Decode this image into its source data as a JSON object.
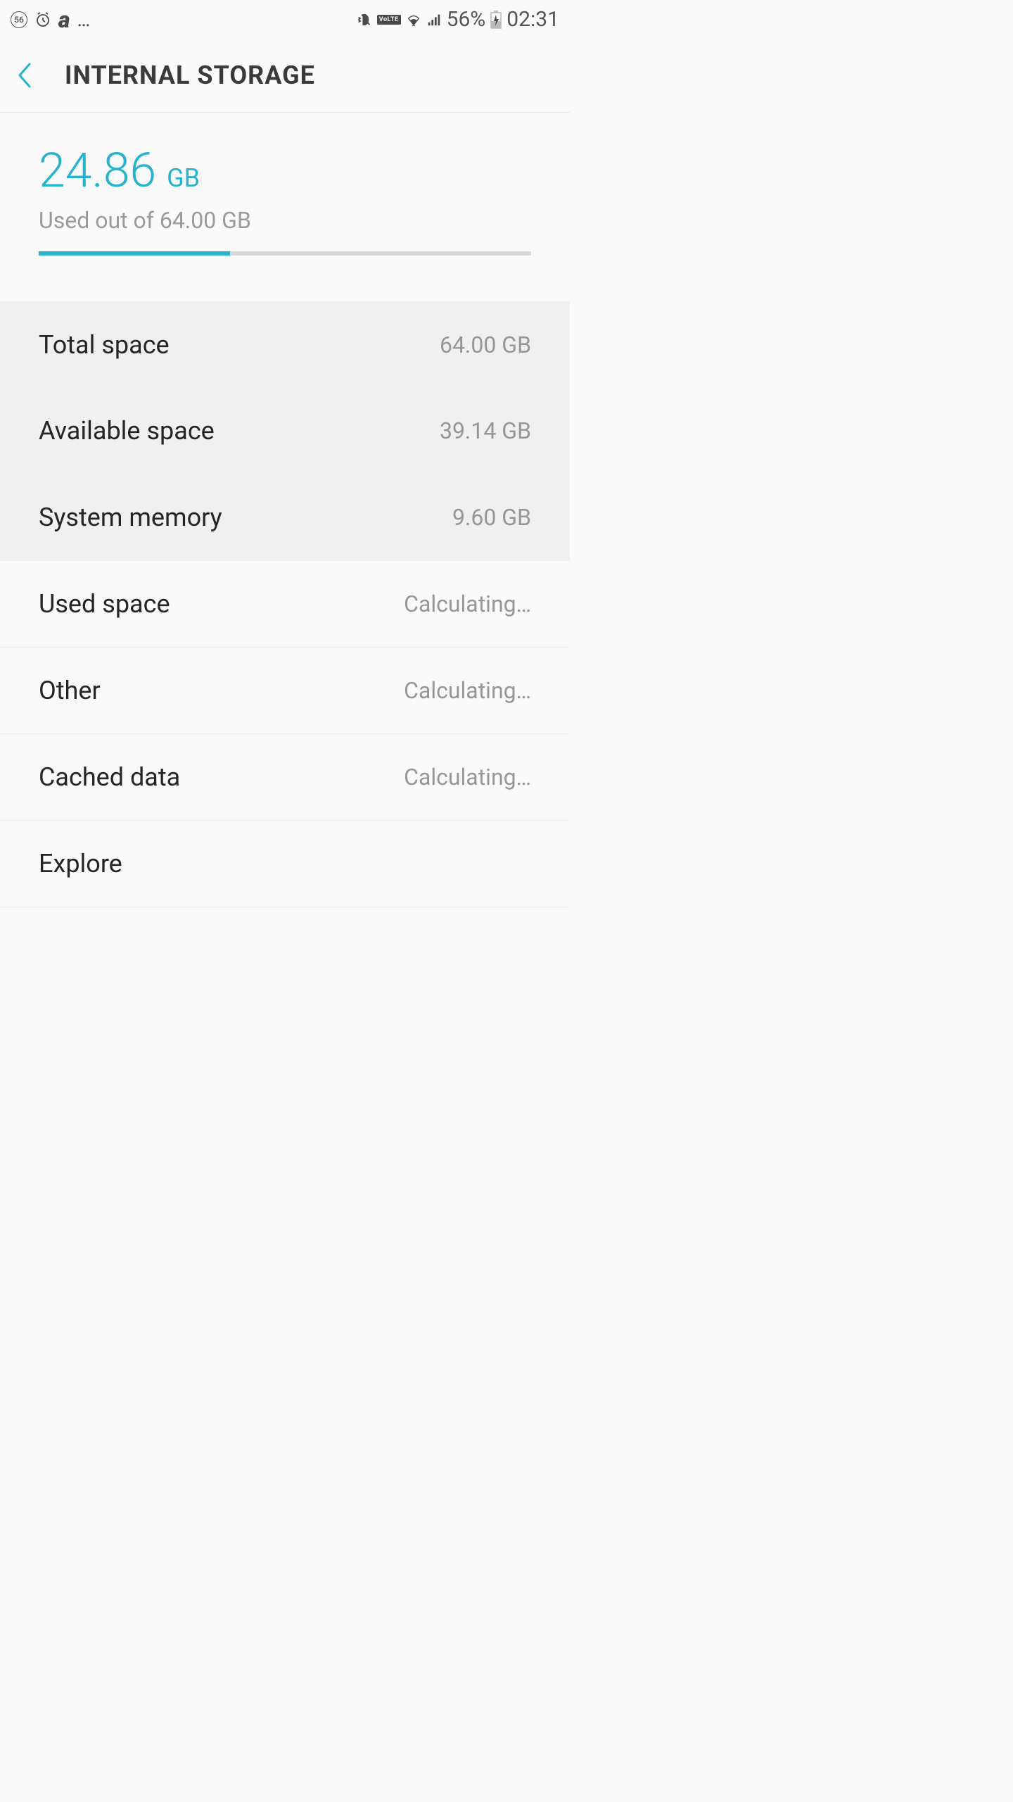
{
  "statusBar": {
    "circleNumber": "56",
    "batteryPercent": "56%",
    "time": "02:31",
    "volte": "VoLTE"
  },
  "header": {
    "title": "INTERNAL STORAGE"
  },
  "summary": {
    "usedNumber": "24.86",
    "usedUnit": "GB",
    "totalText": "Used out of 64.00 GB",
    "progressPercent": 38.8
  },
  "rows": [
    {
      "label": "Total space",
      "value": "64.00 GB",
      "shaded": true
    },
    {
      "label": "Available space",
      "value": "39.14 GB",
      "shaded": true
    },
    {
      "label": "System memory",
      "value": "9.60 GB",
      "shaded": true
    },
    {
      "label": "Used space",
      "value": "Calculating…",
      "shaded": false
    },
    {
      "label": "Other",
      "value": "Calculating…",
      "shaded": false
    },
    {
      "label": "Cached data",
      "value": "Calculating…",
      "shaded": false
    },
    {
      "label": "Explore",
      "value": "",
      "shaded": false
    }
  ]
}
